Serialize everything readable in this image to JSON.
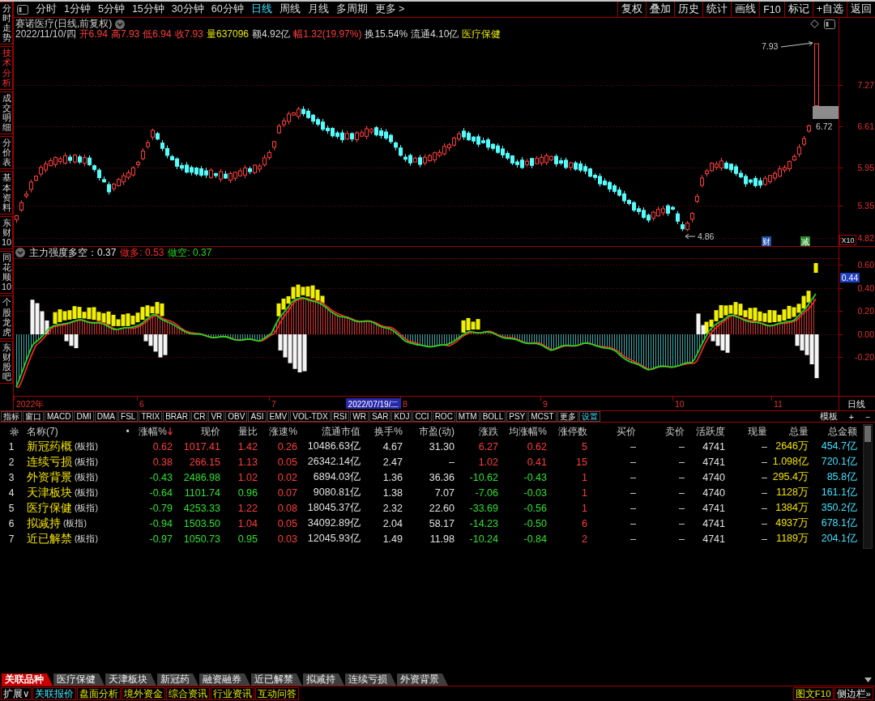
{
  "sidebar": {
    "tabs": [
      {
        "label": "分时走势",
        "selected": false
      },
      {
        "label": "技术分析",
        "selected": true
      },
      {
        "label": "成交明细",
        "selected": false
      },
      {
        "label": "分价表",
        "selected": false
      },
      {
        "label": "基本资料",
        "selected": false
      },
      {
        "label": "东财10",
        "selected": false
      },
      {
        "label": "同花顺10",
        "selected": false
      },
      {
        "label": "个股龙虎",
        "selected": false
      },
      {
        "label": "东财股吧",
        "selected": false
      }
    ]
  },
  "toolbar": {
    "periods": [
      {
        "label": "分时",
        "selected": false
      },
      {
        "label": "1分钟",
        "selected": false
      },
      {
        "label": "5分钟",
        "selected": false
      },
      {
        "label": "15分钟",
        "selected": false
      },
      {
        "label": "30分钟",
        "selected": false
      },
      {
        "label": "60分钟",
        "selected": false
      },
      {
        "label": "日线",
        "selected": true
      },
      {
        "label": "周线",
        "selected": false
      },
      {
        "label": "月线",
        "selected": false
      },
      {
        "label": "多周期",
        "selected": false
      },
      {
        "label": "更多 >",
        "selected": false
      }
    ],
    "actions": [
      "复权",
      "叠加",
      "历史",
      "统计",
      "画线",
      "F10",
      "标记",
      "+自选",
      "返回"
    ]
  },
  "quote": {
    "title": "赛诺医疗(日线,前复权)",
    "date": "2022/11/10/四",
    "fields": [
      {
        "text": "开6.94",
        "color": "#ff3c3c"
      },
      {
        "text": "高7.93",
        "color": "#ff3c3c"
      },
      {
        "text": "低6.94",
        "color": "#ff3c3c"
      },
      {
        "text": "收7.93",
        "color": "#ff3c3c"
      },
      {
        "text": "量637096",
        "color": "#e6e600"
      },
      {
        "text": "额4.92亿",
        "color": "#d8d8d8"
      },
      {
        "text": "幅1.32(19.97%)",
        "color": "#ff3c3c"
      },
      {
        "text": "换15.54%",
        "color": "#d8d8d8"
      },
      {
        "text": "流通4.10亿",
        "color": "#d8d8d8"
      },
      {
        "text": "医疗保健",
        "color": "#e6e600"
      }
    ]
  },
  "price_chart": {
    "high_label": "7.93",
    "last_label": "6.72",
    "low_label": "4.86",
    "axis_labels": [
      "7.27",
      "6.61",
      "5.95",
      "5.35",
      "4.82"
    ],
    "scale": "X10",
    "markers": [
      {
        "text": "财",
        "color": "#1f4fa8"
      },
      {
        "text": "减",
        "color": "#2a8a2a"
      }
    ]
  },
  "indicator": {
    "title": "主力强度多空：0.37",
    "long": "做多: 0.53",
    "short": "做空: 0.37",
    "axis_labels": [
      "0.60",
      "0.40",
      "0.20",
      "0.00",
      "-0.20"
    ],
    "current": "0.44"
  },
  "date_axis": {
    "labels": [
      "2022年",
      "6",
      "7",
      "8",
      "9",
      "10",
      "11"
    ],
    "cursor_date": "2022/07/19/二",
    "period": "日线"
  },
  "indicator_tabs": [
    {
      "label": "指标",
      "kind": "tab"
    },
    {
      "label": "窗口",
      "kind": "tab"
    },
    {
      "label": "MACD",
      "kind": "tab"
    },
    {
      "label": "DMI",
      "kind": "tab"
    },
    {
      "label": "DMA",
      "kind": "tab"
    },
    {
      "label": "FSL",
      "kind": "tab"
    },
    {
      "label": "TRIX",
      "kind": "tab"
    },
    {
      "label": "BRAR",
      "kind": "tab"
    },
    {
      "label": "CR",
      "kind": "tab"
    },
    {
      "label": "VR",
      "kind": "tab"
    },
    {
      "label": "OBV",
      "kind": "tab"
    },
    {
      "label": "ASI",
      "kind": "tab"
    },
    {
      "label": "EMV",
      "kind": "tab"
    },
    {
      "label": "VOL-TDX",
      "kind": "tab"
    },
    {
      "label": "RSI",
      "kind": "tab"
    },
    {
      "label": "WR",
      "kind": "tab"
    },
    {
      "label": "SAR",
      "kind": "tab"
    },
    {
      "label": "KDJ",
      "kind": "tab"
    },
    {
      "label": "CCI",
      "kind": "tab"
    },
    {
      "label": "ROC",
      "kind": "tab"
    },
    {
      "label": "MTM",
      "kind": "tab"
    },
    {
      "label": "BOLL",
      "kind": "tab"
    },
    {
      "label": "PSY",
      "kind": "tab"
    },
    {
      "label": "MCST",
      "kind": "tab"
    },
    {
      "label": "更多",
      "kind": "tab"
    },
    {
      "label": "设置",
      "kind": "action"
    }
  ],
  "indicator_tools": [
    "模板",
    "+",
    "−"
  ],
  "table": {
    "name_header": "名称(7)",
    "dot_header": "•",
    "columns": [
      {
        "label": "涨幅%",
        "kind": "number",
        "sorted": true
      },
      {
        "label": "现价",
        "kind": "number",
        "sorted": false
      },
      {
        "label": "量比",
        "kind": "number",
        "sorted": false
      },
      {
        "label": "涨速%",
        "kind": "number",
        "sorted": false
      },
      {
        "label": "流通市值",
        "kind": "number",
        "sorted": false
      },
      {
        "label": "换手%",
        "kind": "number",
        "sorted": false
      },
      {
        "label": "市盈(动)",
        "kind": "number",
        "sorted": false
      },
      {
        "label": "涨跌",
        "kind": "number",
        "sorted": false
      },
      {
        "label": "均涨幅%",
        "kind": "number",
        "sorted": false
      },
      {
        "label": "涨停数",
        "kind": "number",
        "sorted": false
      },
      {
        "label": "买价",
        "kind": "number",
        "sorted": false
      },
      {
        "label": "卖价",
        "kind": "number",
        "sorted": false
      },
      {
        "label": "活跃度",
        "kind": "number",
        "sorted": false
      },
      {
        "label": "现量",
        "kind": "number",
        "sorted": false
      },
      {
        "label": "总量",
        "kind": "volume",
        "sorted": false
      },
      {
        "label": "总金额",
        "kind": "amount",
        "sorted": false
      }
    ],
    "rows": [
      {
        "index": "1",
        "name": "新冠药概",
        "tag": "(板指)",
        "cells": [
          {
            "text": "0.62",
            "kind": "up"
          },
          {
            "text": "1017.41",
            "kind": "up"
          },
          {
            "text": "1.42",
            "kind": "up"
          },
          {
            "text": "0.26",
            "kind": "up"
          },
          {
            "text": "10486.63亿",
            "kind": "plain"
          },
          {
            "text": "4.67",
            "kind": "plain"
          },
          {
            "text": "31.30",
            "kind": "plain"
          },
          {
            "text": "6.27",
            "kind": "up"
          },
          {
            "text": "0.62",
            "kind": "up"
          },
          {
            "text": "5",
            "kind": "up"
          },
          {
            "text": "–",
            "kind": "plain"
          },
          {
            "text": "–",
            "kind": "plain"
          },
          {
            "text": "4741",
            "kind": "plain"
          },
          {
            "text": "–",
            "kind": "plain"
          },
          {
            "text": "2646万",
            "kind": "plain"
          },
          {
            "text": "454.7亿",
            "kind": "plain"
          }
        ]
      },
      {
        "index": "2",
        "name": "连续亏损",
        "tag": "(板指)",
        "cells": [
          {
            "text": "0.38",
            "kind": "up"
          },
          {
            "text": "266.15",
            "kind": "up"
          },
          {
            "text": "1.13",
            "kind": "up"
          },
          {
            "text": "0.05",
            "kind": "up"
          },
          {
            "text": "26342.14亿",
            "kind": "plain"
          },
          {
            "text": "2.47",
            "kind": "plain"
          },
          {
            "text": "–",
            "kind": "plain"
          },
          {
            "text": "1.02",
            "kind": "up"
          },
          {
            "text": "0.41",
            "kind": "up"
          },
          {
            "text": "15",
            "kind": "up"
          },
          {
            "text": "–",
            "kind": "plain"
          },
          {
            "text": "–",
            "kind": "plain"
          },
          {
            "text": "4741",
            "kind": "plain"
          },
          {
            "text": "–",
            "kind": "plain"
          },
          {
            "text": "1.098亿",
            "kind": "plain"
          },
          {
            "text": "720.1亿",
            "kind": "plain"
          }
        ]
      },
      {
        "index": "3",
        "name": "外资背景",
        "tag": "(板指)",
        "cells": [
          {
            "text": "-0.43",
            "kind": "down"
          },
          {
            "text": "2486.98",
            "kind": "down"
          },
          {
            "text": "1.02",
            "kind": "up"
          },
          {
            "text": "0.02",
            "kind": "up"
          },
          {
            "text": "6894.03亿",
            "kind": "plain"
          },
          {
            "text": "1.36",
            "kind": "plain"
          },
          {
            "text": "36.36",
            "kind": "plain"
          },
          {
            "text": "-10.62",
            "kind": "down"
          },
          {
            "text": "-0.43",
            "kind": "down"
          },
          {
            "text": "1",
            "kind": "up"
          },
          {
            "text": "–",
            "kind": "plain"
          },
          {
            "text": "–",
            "kind": "plain"
          },
          {
            "text": "4740",
            "kind": "plain"
          },
          {
            "text": "–",
            "kind": "plain"
          },
          {
            "text": "295.4万",
            "kind": "plain"
          },
          {
            "text": "85.8亿",
            "kind": "plain"
          }
        ]
      },
      {
        "index": "4",
        "name": "天津板块",
        "tag": "(板指)",
        "cells": [
          {
            "text": "-0.64",
            "kind": "down"
          },
          {
            "text": "1101.74",
            "kind": "down"
          },
          {
            "text": "0.96",
            "kind": "down"
          },
          {
            "text": "0.07",
            "kind": "up"
          },
          {
            "text": "9080.81亿",
            "kind": "plain"
          },
          {
            "text": "1.38",
            "kind": "plain"
          },
          {
            "text": "7.07",
            "kind": "plain"
          },
          {
            "text": "-7.06",
            "kind": "down"
          },
          {
            "text": "-0.03",
            "kind": "down"
          },
          {
            "text": "1",
            "kind": "up"
          },
          {
            "text": "–",
            "kind": "plain"
          },
          {
            "text": "–",
            "kind": "plain"
          },
          {
            "text": "4740",
            "kind": "plain"
          },
          {
            "text": "–",
            "kind": "plain"
          },
          {
            "text": "1128万",
            "kind": "plain"
          },
          {
            "text": "161.1亿",
            "kind": "plain"
          }
        ]
      },
      {
        "index": "5",
        "name": "医疗保健",
        "tag": "(板指)",
        "cells": [
          {
            "text": "-0.79",
            "kind": "down"
          },
          {
            "text": "4253.33",
            "kind": "down"
          },
          {
            "text": "1.22",
            "kind": "up"
          },
          {
            "text": "0.08",
            "kind": "up"
          },
          {
            "text": "18045.37亿",
            "kind": "plain"
          },
          {
            "text": "2.32",
            "kind": "plain"
          },
          {
            "text": "22.60",
            "kind": "plain"
          },
          {
            "text": "-33.69",
            "kind": "down"
          },
          {
            "text": "-0.56",
            "kind": "down"
          },
          {
            "text": "1",
            "kind": "up"
          },
          {
            "text": "–",
            "kind": "plain"
          },
          {
            "text": "–",
            "kind": "plain"
          },
          {
            "text": "4741",
            "kind": "plain"
          },
          {
            "text": "–",
            "kind": "plain"
          },
          {
            "text": "1384万",
            "kind": "plain"
          },
          {
            "text": "350.2亿",
            "kind": "plain"
          }
        ]
      },
      {
        "index": "6",
        "name": "拟减持",
        "tag": "(板指)",
        "cells": [
          {
            "text": "-0.94",
            "kind": "down"
          },
          {
            "text": "1503.50",
            "kind": "down"
          },
          {
            "text": "1.04",
            "kind": "up"
          },
          {
            "text": "0.05",
            "kind": "up"
          },
          {
            "text": "34092.89亿",
            "kind": "plain"
          },
          {
            "text": "2.04",
            "kind": "plain"
          },
          {
            "text": "58.17",
            "kind": "plain"
          },
          {
            "text": "-14.23",
            "kind": "down"
          },
          {
            "text": "-0.50",
            "kind": "down"
          },
          {
            "text": "6",
            "kind": "up"
          },
          {
            "text": "–",
            "kind": "plain"
          },
          {
            "text": "–",
            "kind": "plain"
          },
          {
            "text": "4741",
            "kind": "plain"
          },
          {
            "text": "–",
            "kind": "plain"
          },
          {
            "text": "4937万",
            "kind": "plain"
          },
          {
            "text": "678.1亿",
            "kind": "plain"
          }
        ]
      },
      {
        "index": "7",
        "name": "近已解禁",
        "tag": "(板指)",
        "cells": [
          {
            "text": "-0.97",
            "kind": "down"
          },
          {
            "text": "1050.73",
            "kind": "down"
          },
          {
            "text": "0.95",
            "kind": "down"
          },
          {
            "text": "0.03",
            "kind": "up"
          },
          {
            "text": "12045.93亿",
            "kind": "plain"
          },
          {
            "text": "1.49",
            "kind": "plain"
          },
          {
            "text": "11.98",
            "kind": "plain"
          },
          {
            "text": "-10.24",
            "kind": "down"
          },
          {
            "text": "-0.84",
            "kind": "down"
          },
          {
            "text": "2",
            "kind": "up"
          },
          {
            "text": "–",
            "kind": "plain"
          },
          {
            "text": "–",
            "kind": "plain"
          },
          {
            "text": "4741",
            "kind": "plain"
          },
          {
            "text": "–",
            "kind": "plain"
          },
          {
            "text": "1189万",
            "kind": "plain"
          },
          {
            "text": "204.1亿",
            "kind": "plain"
          }
        ]
      }
    ]
  },
  "sector_tabs": [
    {
      "label": "关联品种",
      "selected": true
    },
    {
      "label": "医疗保健",
      "selected": false
    },
    {
      "label": "天津板块",
      "selected": false
    },
    {
      "label": "新冠药",
      "selected": false
    },
    {
      "label": "融资融券",
      "selected": false
    },
    {
      "label": "近已解禁",
      "selected": false
    },
    {
      "label": "拟减持",
      "selected": false
    },
    {
      "label": "连续亏损",
      "selected": false
    },
    {
      "label": "外资背景",
      "selected": false
    }
  ],
  "status_bar": {
    "items": [
      {
        "label": "扩展∨",
        "kind": "menu",
        "selected": false
      },
      {
        "label": "关联报价",
        "kind": "tab",
        "selected": true
      },
      {
        "label": "盘面分析",
        "kind": "tab",
        "selected": false
      },
      {
        "label": "境外资金",
        "kind": "tab",
        "selected": false
      },
      {
        "label": "综合资讯",
        "kind": "tab",
        "selected": false
      },
      {
        "label": "行业资讯",
        "kind": "tab",
        "selected": false
      },
      {
        "label": "互动问答",
        "kind": "tab",
        "selected": false
      }
    ],
    "right_items": [
      {
        "label": "图文F10",
        "kind": "tab",
        "selected": false
      },
      {
        "label": "侧边栏»",
        "kind": "menu",
        "selected": false
      }
    ]
  }
}
